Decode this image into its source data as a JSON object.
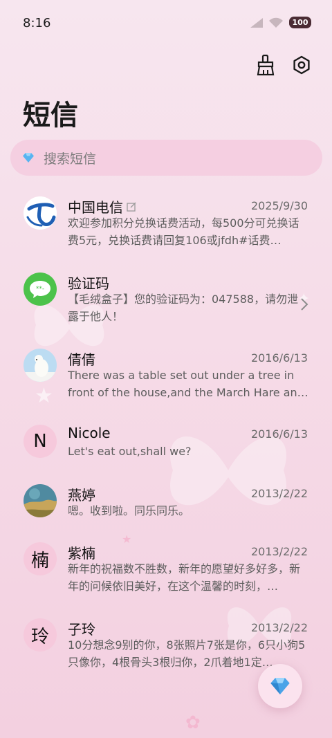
{
  "status_bar": {
    "time": "8:16",
    "battery": "100"
  },
  "header": {
    "title": "短信",
    "clean_icon": "broom-icon",
    "settings_icon": "gear-icon"
  },
  "search": {
    "placeholder": "搜索短信",
    "icon": "diamond-icon"
  },
  "conversations": [
    {
      "name": "中国电信",
      "date": "2025/9/30",
      "preview": "欢迎参加积分兑换话费活动，每500分可兑换话费5元，兑换话费请回复106或jfdh#话费…",
      "avatar": "china-telecom-logo",
      "has_edit_badge": true
    },
    {
      "name": "验证码",
      "date": "",
      "preview": "【毛绒盒子】您的验证码为：047588，请勿泄露于他人！",
      "avatar": "message-bubble-icon"
    },
    {
      "name": "倩倩",
      "date": "2016/6/13",
      "preview": "There was a table set out under a tree in front of the house,and the March Hare an…",
      "avatar": "polar-bear-photo"
    },
    {
      "name": "Nicole",
      "date": "2016/6/13",
      "preview": "Let's eat out,shall we?",
      "avatar_letter": "N"
    },
    {
      "name": "燕婷",
      "date": "2013/2/22",
      "preview": "嗯。收到啦。同乐同乐。",
      "avatar": "landscape-photo"
    },
    {
      "name": "紫楠",
      "date": "2013/2/22",
      "preview": "新年的祝福数不胜数，新年的愿望好多好多，新年的问候依旧美好，在这个温馨的时刻，…",
      "avatar_letter": "楠"
    },
    {
      "name": "子玲",
      "date": "2013/2/22",
      "preview": "10分想念9别的你，8张照片7张是你，6只小狗5只像你，4根骨头3根归你，2爪着地1定…",
      "avatar_letter": "玲"
    }
  ],
  "fab": {
    "icon": "diamond-icon"
  },
  "colors": {
    "accent": "#4aa3e8",
    "wechat_green": "#4cc24a",
    "telecom_blue": "#1f5fb4"
  }
}
